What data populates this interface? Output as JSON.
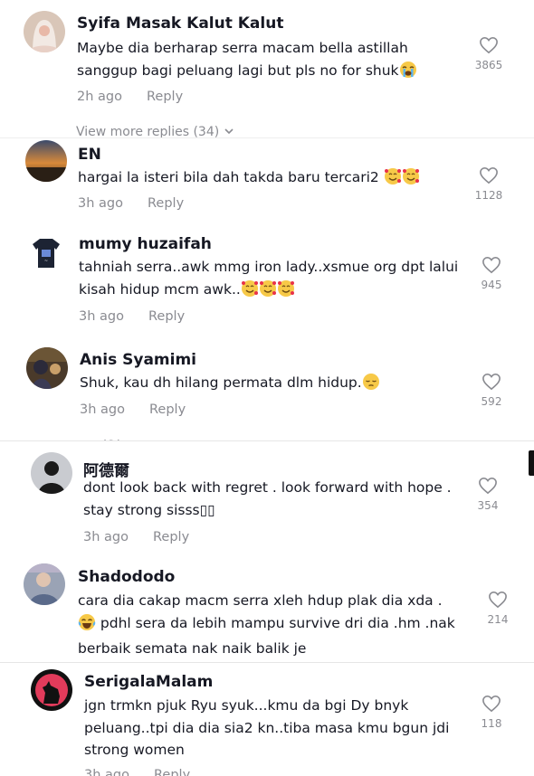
{
  "comments": [
    {
      "username": "Syifa Masak Kalut Kalut",
      "text": "Maybe dia berharap serra macam bella astillah sanggup bagi peluang lagi but pls no for shuk",
      "time": "2h ago",
      "reply_label": "Reply",
      "likes": "3865",
      "emojis": [
        "loudly-crying-face"
      ]
    },
    {
      "username": "EN",
      "text": "hargai la isteri bila dah takda baru tercari2",
      "time": "3h ago",
      "reply_label": "Reply",
      "likes": "1128",
      "emojis": [
        "smiling-face-with-hearts",
        "smiling-face-with-hearts"
      ]
    },
    {
      "username": "mumy huzaifah",
      "text": "tahniah serra..awk mmg iron lady..xsmue org dpt lalui kisah hidup mcm awk..",
      "time": "3h ago",
      "reply_label": "Reply",
      "likes": "945",
      "emojis": [
        "smiling-face-with-hearts",
        "smiling-face-with-hearts",
        "smiling-face-with-hearts"
      ]
    },
    {
      "username": "Anis Syamimi",
      "text": "Shuk, kau dh hilang permata dlm hidup.",
      "time": "3h ago",
      "reply_label": "Reply",
      "likes": "592",
      "emojis": [
        "pensive-face"
      ]
    },
    {
      "username": "阿德爾",
      "text": "dont look back with regret . look forward with hope . stay strong sisss▯▯",
      "time": "3h ago",
      "reply_label": "Reply",
      "likes": "354",
      "emojis": []
    },
    {
      "username": "Shadododo",
      "text": "cara dia cakap macm serra xleh hdup plak dia xda .",
      "text2": " pdhl sera da lebih mampu survive dri dia .hm .nak berbaik semata nak naik balik je",
      "time": "",
      "reply_label": "",
      "likes": "214",
      "emojis": [
        "face-with-tears-of-joy"
      ]
    },
    {
      "username": "SerigalaMalam",
      "text": "jgn trmkn pjuk Ryu syuk...kmu da bgi Dy bnyk peluang..tpi dia dia sia2 kn..tiba masa kmu bgun jdi strong women",
      "time": "3h ago",
      "reply_label": "Reply",
      "likes": "118",
      "emojis": []
    }
  ],
  "view_more_replies": "View more replies (34)",
  "icons": {
    "like": "heart-outline-icon",
    "view_more": "chevron-down-icon"
  },
  "colors": {
    "text": "#161823",
    "secondary": "#8a8b91"
  }
}
